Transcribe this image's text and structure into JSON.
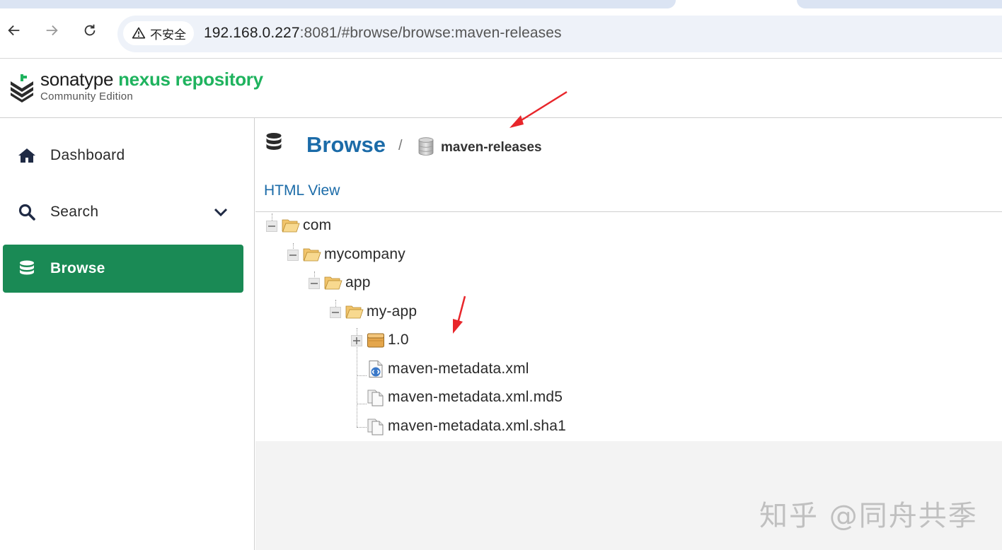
{
  "browser": {
    "security_label": "不安全",
    "url_host": "192.168.0.227",
    "url_rest": ":8081/#browse/browse:maven-releases"
  },
  "header": {
    "brand_part1": "sonatype ",
    "brand_part2": "nexus repository",
    "edition": "Community Edition"
  },
  "sidebar": {
    "items": [
      {
        "label": "Dashboard",
        "icon": "home-icon"
      },
      {
        "label": "Search",
        "icon": "search-icon"
      },
      {
        "label": "Browse",
        "icon": "database-icon",
        "active": true
      }
    ]
  },
  "breadcrumb": {
    "title": "Browse",
    "separator": "/",
    "repo": "maven-releases"
  },
  "main": {
    "html_view_link": "HTML View"
  },
  "tree": {
    "nodes": [
      {
        "label": "com",
        "type": "folder-open",
        "expander": "minus"
      },
      {
        "label": "mycompany",
        "type": "folder-open",
        "expander": "minus"
      },
      {
        "label": "app",
        "type": "folder-open",
        "expander": "minus"
      },
      {
        "label": "my-app",
        "type": "folder-open",
        "expander": "minus"
      },
      {
        "label": "1.0",
        "type": "component",
        "expander": "plus"
      },
      {
        "label": "maven-metadata.xml",
        "type": "xml-file"
      },
      {
        "label": "maven-metadata.xml.md5",
        "type": "file"
      },
      {
        "label": "maven-metadata.xml.sha1",
        "type": "file"
      }
    ]
  },
  "watermark": "知乎 @同舟共季",
  "colors": {
    "brand_green": "#1fb35e",
    "active_nav": "#1a8a55",
    "link_blue": "#1b6ba8",
    "annotation_red": "#e8262b"
  }
}
